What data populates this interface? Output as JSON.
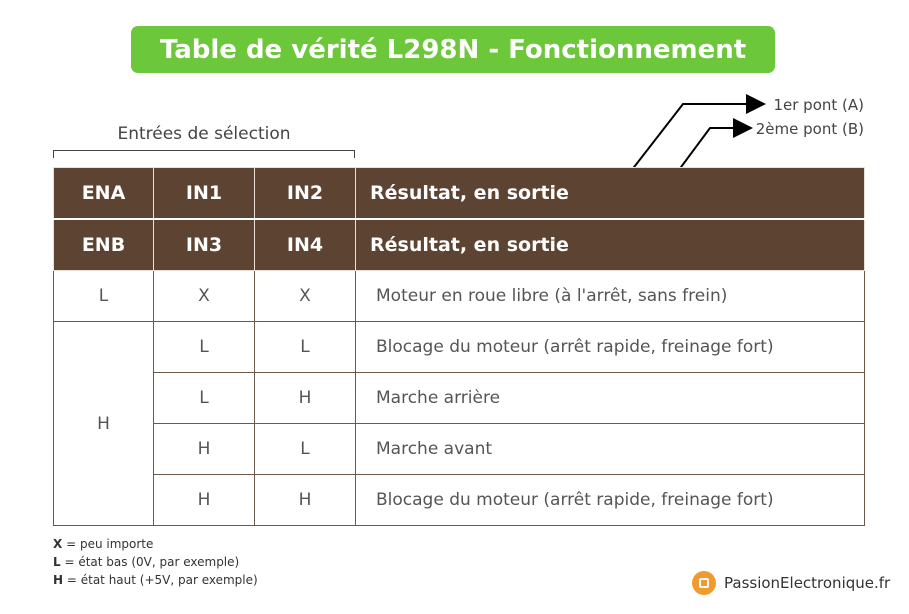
{
  "title": "Table de vérité L298N - Fonctionnement",
  "selection_label": "Entrées de sélection",
  "bridges": {
    "a": "1er pont (A)",
    "b": "2ème pont (B)"
  },
  "header_rows": [
    [
      "ENA",
      "IN1",
      "IN2",
      "Résultat, en sortie"
    ],
    [
      "ENB",
      "IN3",
      "IN4",
      "Résultat, en sortie"
    ]
  ],
  "rows": [
    {
      "en": "L",
      "in_a": "X",
      "in_b": "X",
      "result": "Moteur en roue libre (à l'arrêt, sans frein)"
    },
    {
      "en": "H",
      "in_a": "L",
      "in_b": "L",
      "result": "Blocage du moteur (arrêt rapide, freinage fort)"
    },
    {
      "en": "",
      "in_a": "L",
      "in_b": "H",
      "result": "Marche arrière"
    },
    {
      "en": "",
      "in_a": "H",
      "in_b": "L",
      "result": "Marche avant"
    },
    {
      "en": "",
      "in_a": "H",
      "in_b": "H",
      "result": "Blocage du moteur (arrêt rapide, freinage fort)"
    }
  ],
  "legend": [
    {
      "key": "X",
      "text": " = peu importe"
    },
    {
      "key": "L",
      "text": " = état bas (0V, par exemple)"
    },
    {
      "key": "H",
      "text": " = état haut (+5V, par exemple)"
    }
  ],
  "brand": "PassionElectronique.fr",
  "colors": {
    "title_bg": "#6cc83a",
    "header_bg": "#5d4331",
    "border": "#6b5a4a",
    "brand_logo": "#f19a2e"
  }
}
